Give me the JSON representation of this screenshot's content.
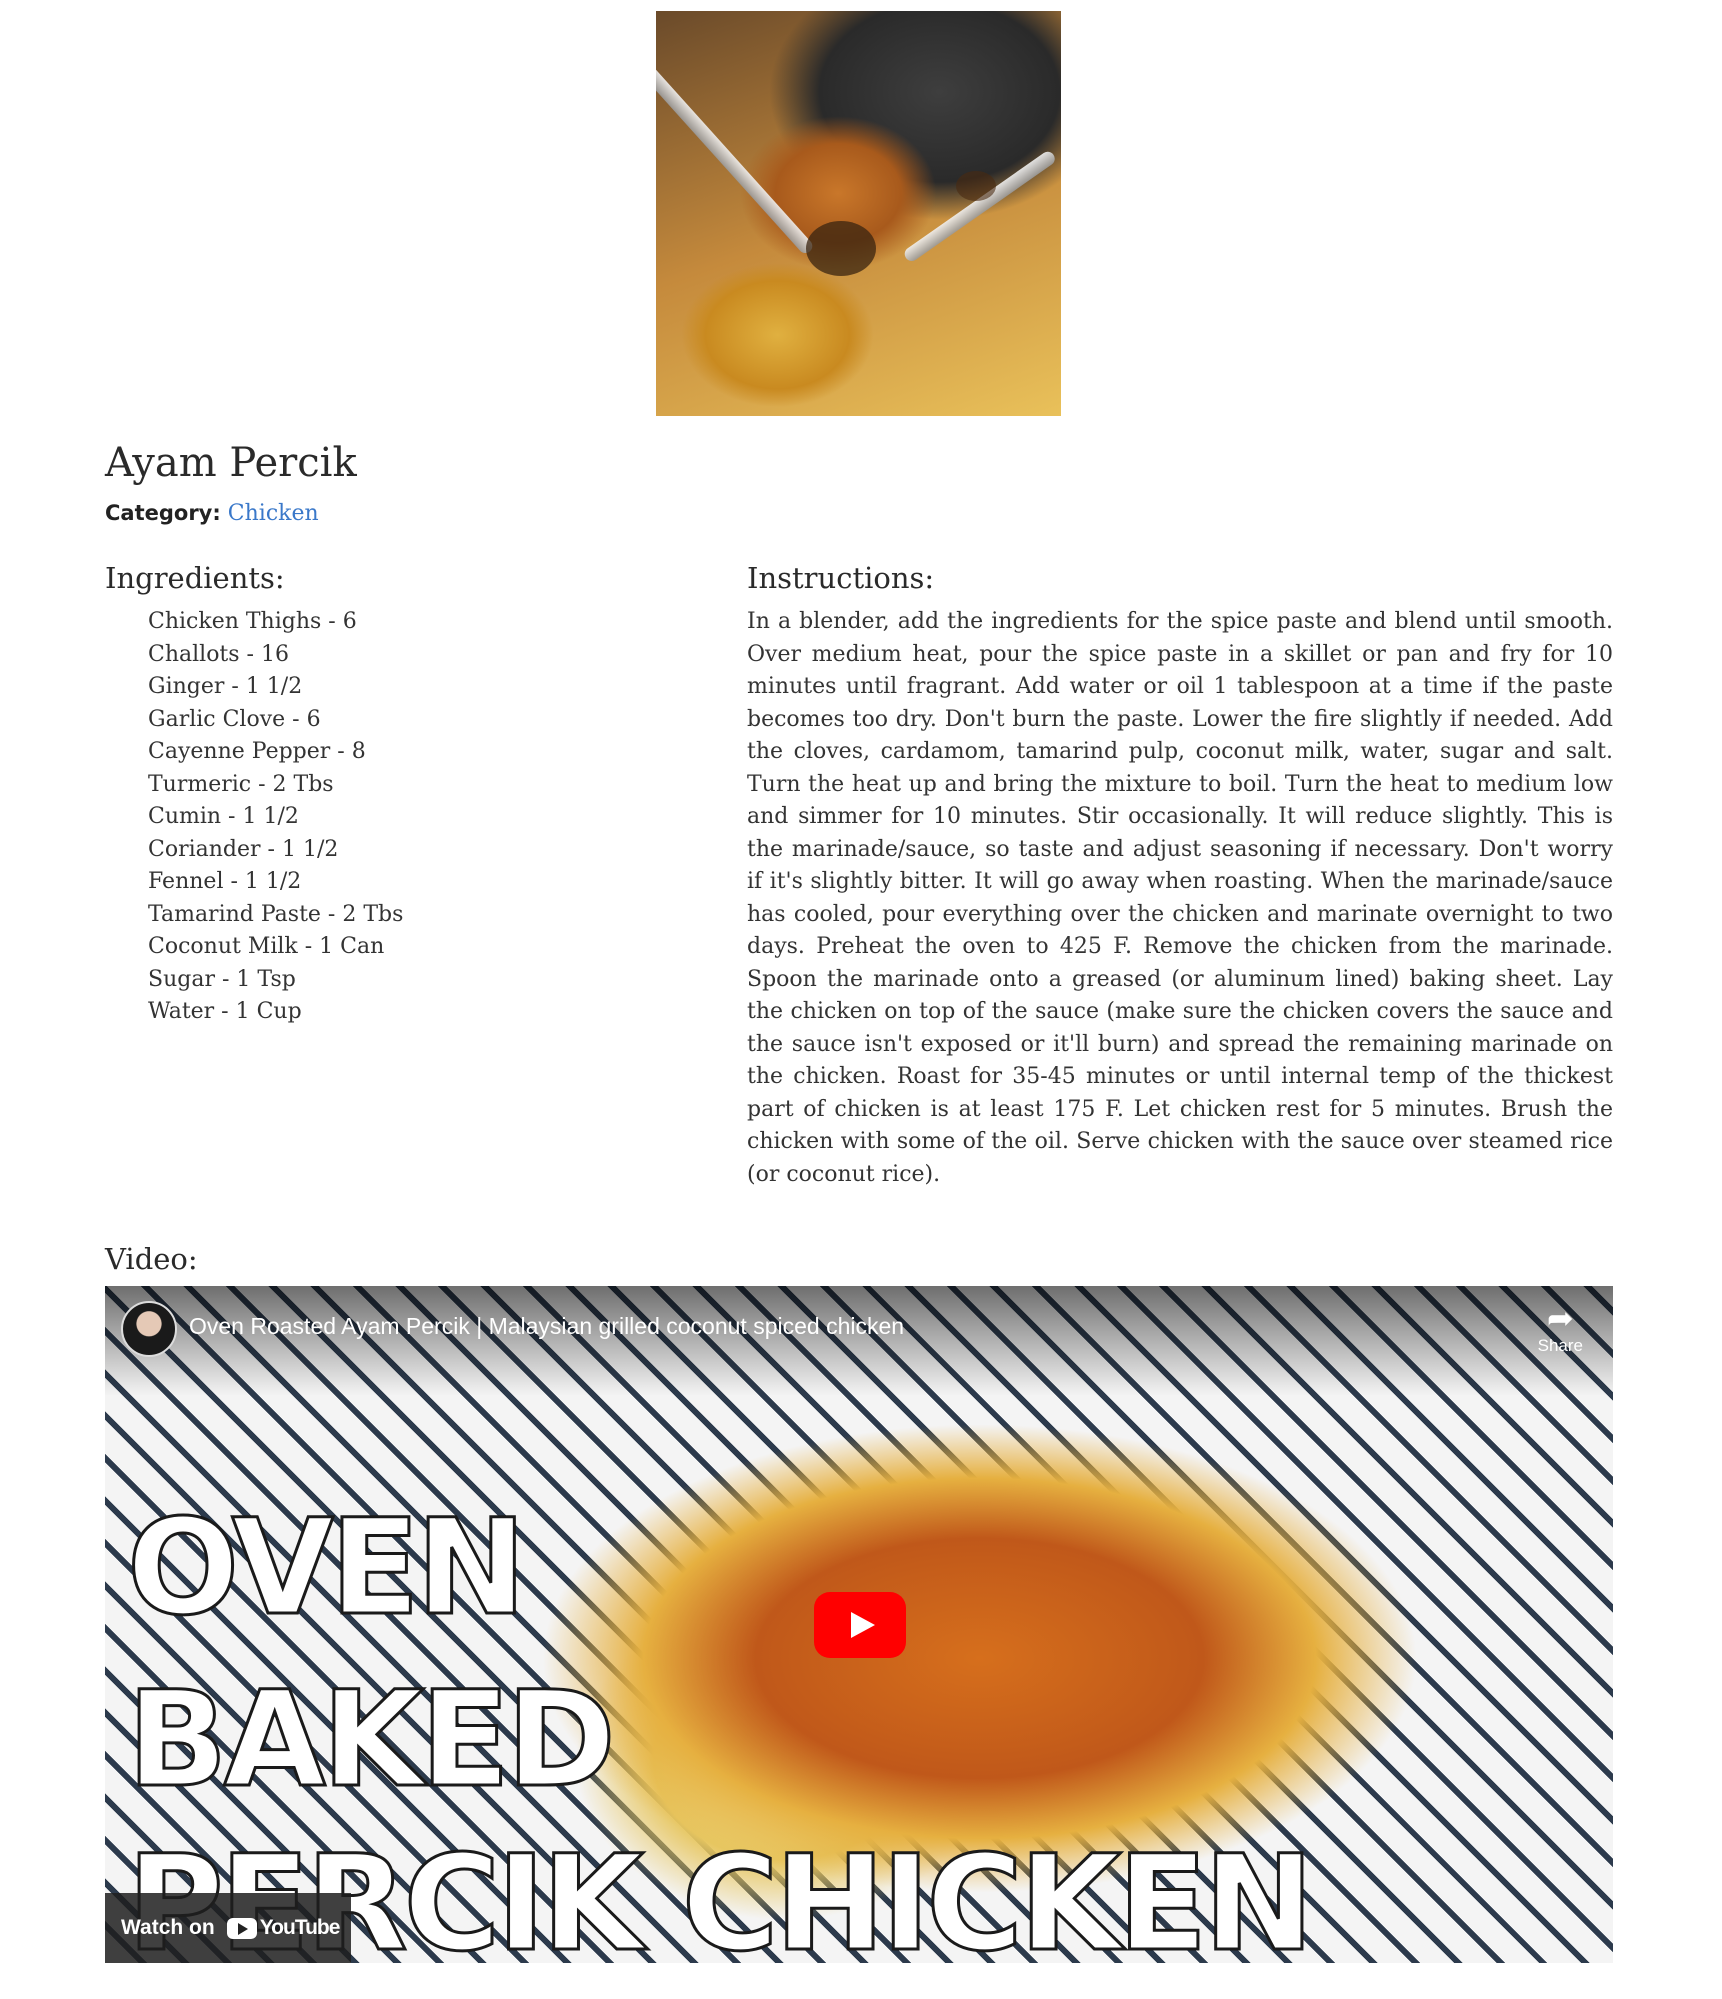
{
  "recipe": {
    "title": "Ayam Percik",
    "category_label": "Category:",
    "category_value": "Chicken"
  },
  "ingredients": {
    "heading": "Ingredients:",
    "items": [
      "Chicken Thighs - 6",
      "Challots - 16",
      "Ginger - 1 1/2",
      "Garlic Clove - 6",
      "Cayenne Pepper - 8",
      "Turmeric - 2 Tbs",
      "Cumin - 1 1/2",
      "Coriander - 1 1/2",
      "Fennel - 1 1/2",
      "Tamarind Paste - 2 Tbs",
      "Coconut Milk - 1 Can",
      "Sugar - 1 Tsp",
      "Water - 1 Cup"
    ]
  },
  "instructions": {
    "heading": "Instructions:",
    "text": "In a blender, add the ingredients for the spice paste and blend until smooth. Over medium heat, pour the spice paste in a skillet or pan and fry for 10 minutes until fragrant. Add water or oil 1 tablespoon at a time if the paste becomes too dry. Don't burn the paste. Lower the fire slightly if needed. Add the cloves, cardamom, tamarind pulp, coconut milk, water, sugar and salt. Turn the heat up and bring the mixture to boil. Turn the heat to medium low and simmer for 10 minutes. Stir occasionally. It will reduce slightly. This is the marinade/sauce, so taste and adjust seasoning if necessary. Don't worry if it's slightly bitter. It will go away when roasting. When the marinade/sauce has cooled, pour everything over the chicken and marinate overnight to two days. Preheat the oven to 425 F. Remove the chicken from the marinade. Spoon the marinade onto a greased (or aluminum lined) baking sheet. Lay the chicken on top of the sauce (make sure the chicken covers the sauce and the sauce isn't exposed or it'll burn) and spread the remaining marinade on the chicken. Roast for 35-45 minutes or until internal temp of the thickest part of chicken is at least 175 F. Let chicken rest for 5 minutes. Brush the chicken with some of the oil. Serve chicken with the sauce over steamed rice (or coconut rice)."
  },
  "video": {
    "heading": "Video:",
    "title": "Oven Roasted Ayam Percik | Malaysian grilled coconut spiced chicken",
    "share_label": "Share",
    "overlay_lines": [
      "OVEN",
      "BAKED",
      "PERCIK CHICKEN"
    ],
    "watch_on": "Watch on",
    "youtube_label": "YouTube"
  },
  "colors": {
    "link": "#3a78c9",
    "play_button": "#ff0000"
  }
}
